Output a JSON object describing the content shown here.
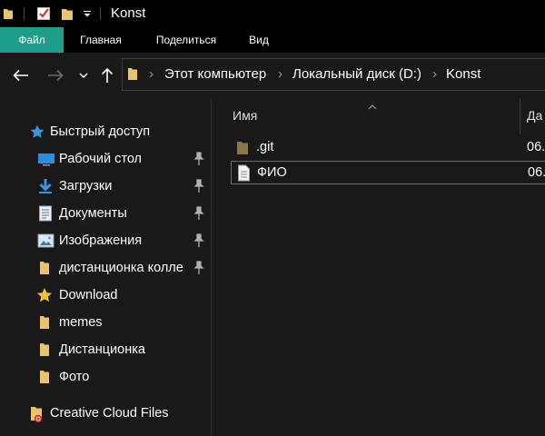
{
  "window": {
    "title": "Konst"
  },
  "ribbon": {
    "tabs": [
      "Файл",
      "Главная",
      "Поделиться",
      "Вид"
    ]
  },
  "address": {
    "crumbs": [
      "Этот компьютер",
      "Локальный диск (D:)",
      "Konst"
    ]
  },
  "sidebar": {
    "quick_access": "Быстрый доступ",
    "items": [
      {
        "label": "Рабочий стол",
        "icon": "desktop-icon",
        "pinned": true
      },
      {
        "label": "Загрузки",
        "icon": "downloads-icon",
        "pinned": true
      },
      {
        "label": "Документы",
        "icon": "documents-icon",
        "pinned": true
      },
      {
        "label": "Изображения",
        "icon": "pictures-icon",
        "pinned": true
      },
      {
        "label": "дистанционка колле",
        "icon": "folder-icon",
        "pinned": true
      },
      {
        "label": "Download",
        "icon": "star-folder-icon",
        "pinned": false
      },
      {
        "label": "memes",
        "icon": "folder-icon",
        "pinned": false
      },
      {
        "label": "Дистанционка",
        "icon": "folder-icon",
        "pinned": false
      },
      {
        "label": "Фото",
        "icon": "folder-icon",
        "pinned": false
      }
    ],
    "creative_cloud": "Creative Cloud Files"
  },
  "list": {
    "col_name": "Имя",
    "col_date": "Да",
    "files": [
      {
        "name": ".git",
        "date": "06.",
        "icon": "folder-icon",
        "selected": false
      },
      {
        "name": "ФИО",
        "date": "06.",
        "icon": "text-file-icon",
        "selected": true
      }
    ]
  },
  "colors": {
    "accent_file_tab": "#1f9d8b",
    "folder": "#e8c46a",
    "background": "#191919",
    "chrome": "#000000"
  }
}
